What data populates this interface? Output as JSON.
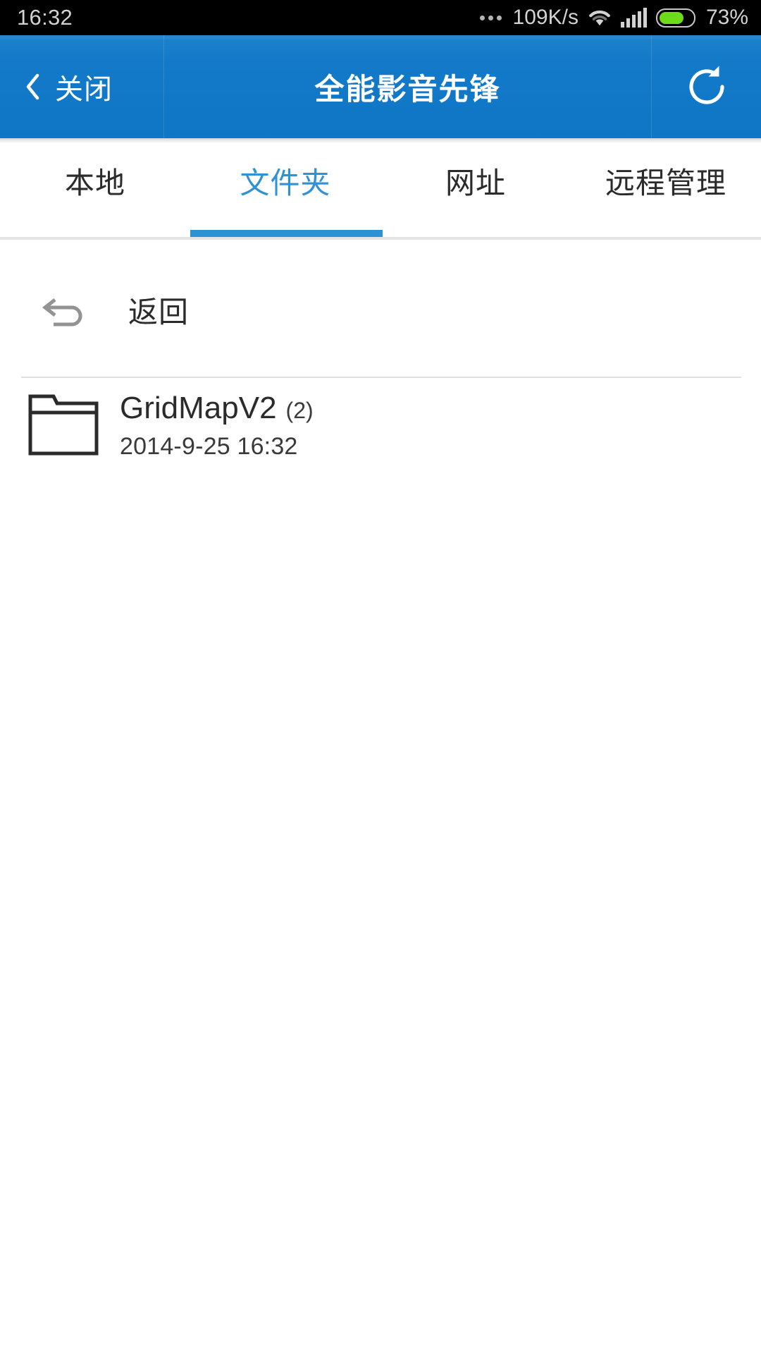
{
  "status_bar": {
    "time": "16:32",
    "overflow_icon": "more-dots-icon",
    "network_speed": "109K/s",
    "wifi_icon": "wifi-icon",
    "signal_icon": "cellular-signal-icon",
    "battery_icon": "battery-icon",
    "battery_percent": "73%",
    "battery_level": 73,
    "battery_color": "#6fdc1a",
    "background": "#000000",
    "text_color": "#d2d2d2"
  },
  "header": {
    "back_icon": "chevron-left-icon",
    "close_label": "关闭",
    "title": "全能影音先锋",
    "refresh_icon": "refresh-icon",
    "background": "#1379c8",
    "text_color": "#ffffff"
  },
  "tabs": {
    "items": [
      {
        "label": "本地",
        "active": false
      },
      {
        "label": "文件夹",
        "active": true
      },
      {
        "label": "网址",
        "active": false
      },
      {
        "label": "远程管理",
        "active": false
      }
    ],
    "active_index": 1,
    "active_color": "#2f91d6",
    "inactive_color": "#2b2b2b",
    "indicator_color": "#2b92d4"
  },
  "list": {
    "back_row": {
      "icon": "return-arrow-icon",
      "label": "返回"
    },
    "items": [
      {
        "icon": "folder-icon",
        "name": "GridMapV2",
        "count": "(2)",
        "date": "2014-9-25 16:32"
      }
    ]
  }
}
